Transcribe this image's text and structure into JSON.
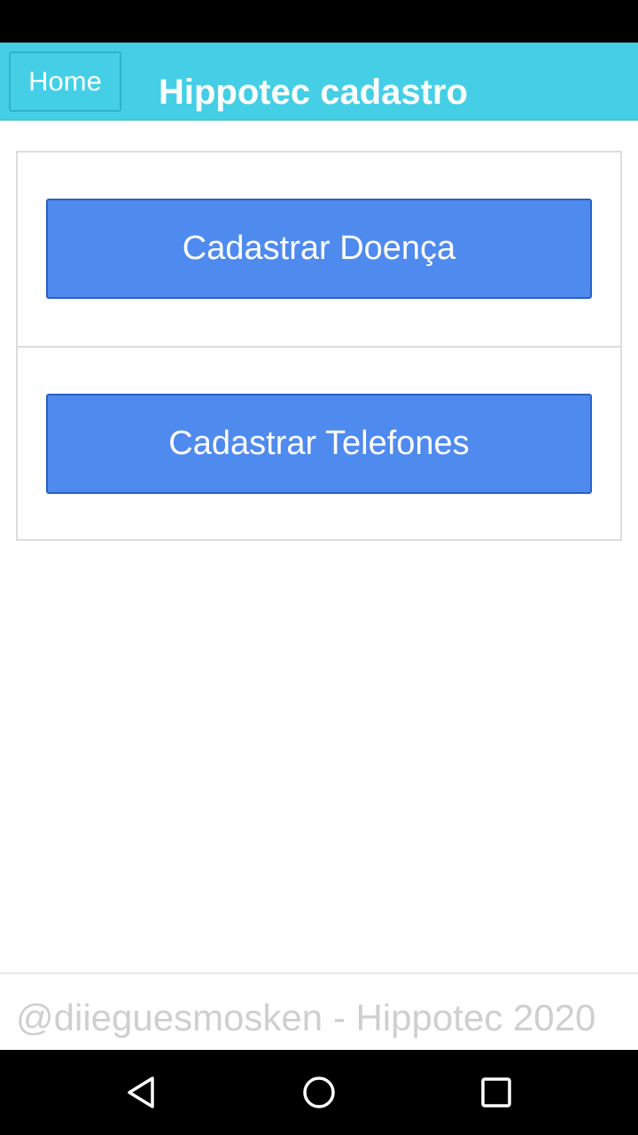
{
  "header": {
    "home_label": "Home",
    "title": "Hippotec cadastro",
    "background_color": "#44cfe6"
  },
  "actions": [
    {
      "label": "Cadastrar Doença"
    },
    {
      "label": "Cadastrar Telefones"
    }
  ],
  "button_color": "#4f8aef",
  "footer": {
    "text": "@diieguesmosken - Hippotec 2020"
  },
  "nav": {
    "icons": [
      "back-icon",
      "home-icon",
      "recents-icon"
    ]
  }
}
